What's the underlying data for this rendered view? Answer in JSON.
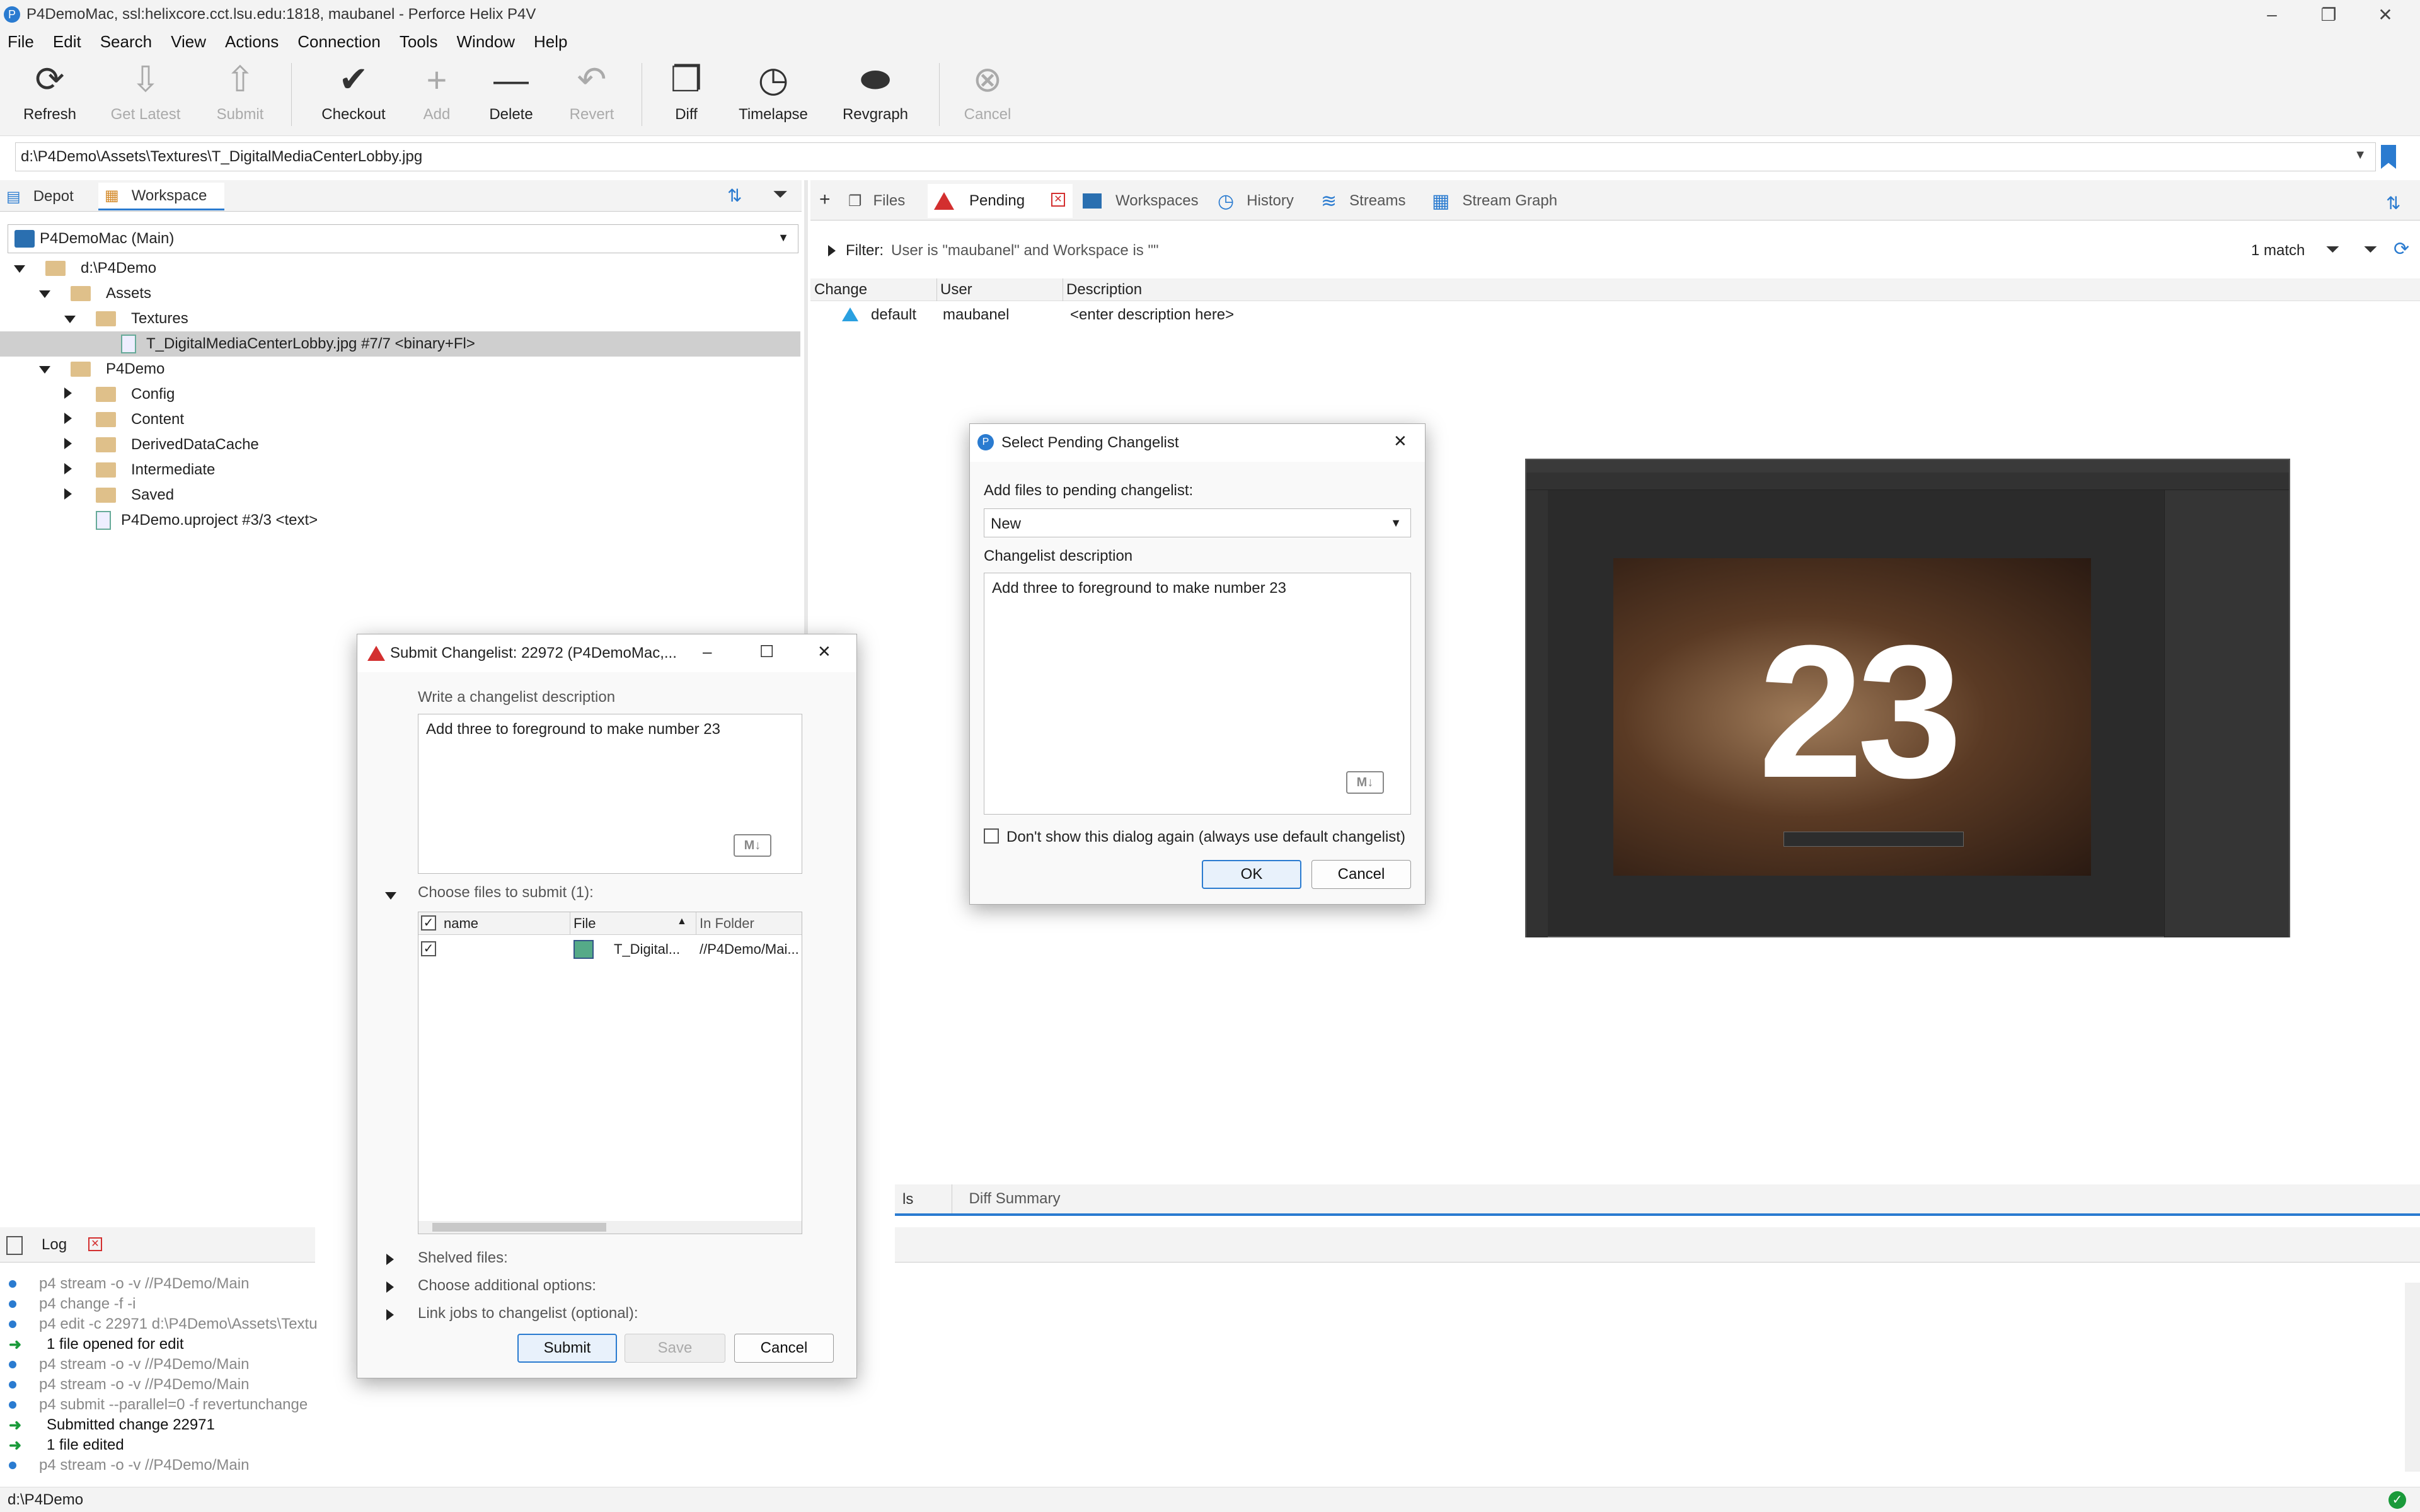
{
  "window": {
    "title": "P4DemoMac,  ssl:helixcore.cct.lsu.edu:1818,  maubanel - Perforce Helix P4V",
    "controls": [
      "–",
      "❐",
      "✕"
    ]
  },
  "menu": [
    "File",
    "Edit",
    "Search",
    "View",
    "Actions",
    "Connection",
    "Tools",
    "Window",
    "Help"
  ],
  "toolbar": {
    "refresh": "Refresh",
    "get_latest": "Get Latest",
    "submit": "Submit",
    "checkout": "Checkout",
    "add": "Add",
    "delete": "Delete",
    "revert": "Revert",
    "diff": "Diff",
    "timelapse": "Timelapse",
    "revgraph": "Revgraph",
    "cancel": "Cancel"
  },
  "path_bar": {
    "value": "d:\\P4Demo\\Assets\\Textures\\T_DigitalMediaCenterLobby.jpg"
  },
  "left_pane": {
    "tabs": [
      "Depot",
      "Workspace"
    ],
    "active_tab": "Workspace",
    "workspace_select": "P4DemoMac (Main)",
    "tree": [
      {
        "label": "d:\\P4Demo",
        "depth": 0,
        "expanded": true
      },
      {
        "label": "Assets",
        "depth": 1,
        "expanded": true
      },
      {
        "label": "Textures",
        "depth": 2,
        "expanded": true
      },
      {
        "label": "T_DigitalMediaCenterLobby.jpg #7/7 <binary+Fl>",
        "depth": 3,
        "file": true,
        "selected": true
      },
      {
        "label": "P4Demo",
        "depth": 1,
        "expanded": true
      },
      {
        "label": "Config",
        "depth": 2,
        "expanded": false
      },
      {
        "label": "Content",
        "depth": 2,
        "expanded": false
      },
      {
        "label": "DerivedDataCache",
        "depth": 2,
        "expanded": false
      },
      {
        "label": "Intermediate",
        "depth": 2,
        "expanded": false
      },
      {
        "label": "Saved",
        "depth": 2,
        "expanded": false
      },
      {
        "label": "P4Demo.uproject #3/3 <text>",
        "depth": 2,
        "file": true
      }
    ]
  },
  "right_pane": {
    "tabs": [
      "Files",
      "Pending",
      "Workspaces",
      "History",
      "Streams",
      "Stream Graph"
    ],
    "active_tab": "Pending",
    "filter_label": "Filter:",
    "filter_text": "User is \"maubanel\" and Workspace is \"\"",
    "match_count": "1 match",
    "columns": [
      "Change",
      "User",
      "Description"
    ],
    "rows": [
      {
        "change": "default",
        "user": "maubanel",
        "description": "<enter description here>"
      }
    ]
  },
  "photo": {
    "overlay_number": "23"
  },
  "bottom_tabs": [
    "ls",
    "Diff Summary"
  ],
  "log": {
    "tab": "Log",
    "lines": [
      {
        "kind": "cmd",
        "text": "p4 stream -o -v //P4Demo/Main"
      },
      {
        "kind": "cmd",
        "text": "p4 change -f -i"
      },
      {
        "kind": "cmd",
        "text": "p4 edit -c 22971 d:\\P4Demo\\Assets\\Textu"
      },
      {
        "kind": "ok",
        "text": "1 file opened for edit"
      },
      {
        "kind": "cmd",
        "text": "p4 stream -o -v //P4Demo/Main"
      },
      {
        "kind": "cmd",
        "text": "p4 stream -o -v //P4Demo/Main"
      },
      {
        "kind": "cmd",
        "text": "p4 submit --parallel=0 -f revertunchange"
      },
      {
        "kind": "ok",
        "text": "Submitted change 22971"
      },
      {
        "kind": "ok",
        "text": "1 file edited"
      },
      {
        "kind": "cmd",
        "text": "p4 stream -o -v //P4Demo/Main"
      }
    ]
  },
  "status_bar": {
    "path": "d:\\P4Demo"
  },
  "submit_dialog": {
    "title": "Submit Changelist: 22972 (P4DemoMac,...",
    "desc_label": "Write a changelist description",
    "desc_value": "Add three to foreground to make number 23",
    "files_label": "Choose files to submit (1):",
    "columns": [
      "name",
      "File",
      "In Folder"
    ],
    "file_row": {
      "file": "T_Digital...",
      "folder": "//P4Demo/Mai..."
    },
    "shelved_label": "Shelved files:",
    "options_label": "Choose additional options:",
    "jobs_label": "Link jobs to changelist (optional):",
    "submit_btn": "Submit",
    "save_btn": "Save",
    "cancel_btn": "Cancel"
  },
  "pending_dialog": {
    "title": "Select Pending Changelist",
    "add_label": "Add files to pending changelist:",
    "select_value": "New",
    "desc_label": "Changelist description",
    "desc_value": "Add three to foreground to make number 23",
    "dont_show": "Don't show this dialog again (always use default changelist)",
    "ok_btn": "OK",
    "cancel_btn": "Cancel"
  },
  "colors": {
    "accent": "#2a7bd0",
    "pending_red": "#d32f2f",
    "ok_green": "#1a9a3a"
  }
}
